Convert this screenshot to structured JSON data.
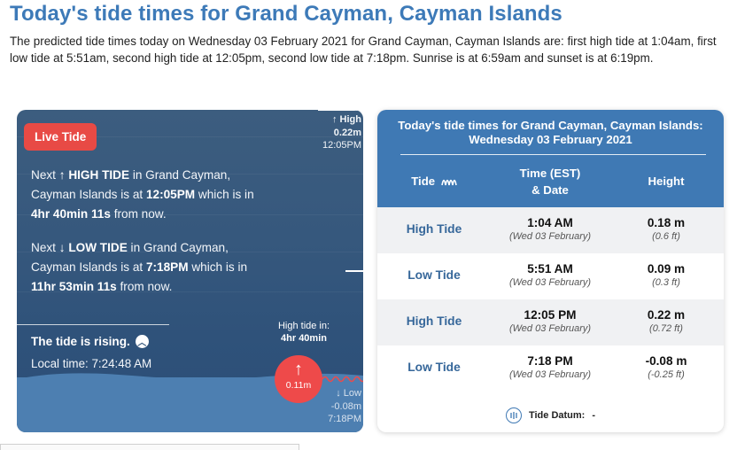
{
  "page": {
    "title": "Today's tide times for Grand Cayman, Cayman Islands",
    "summary": "The predicted tide times today on Wednesday 03 February 2021 for Grand Cayman, Cayman Islands are: first high tide at 1:04am, first low tide at 5:51am, second high tide at 12:05pm, second low tide at 7:18pm. Sunrise is at 6:59am and sunset is at 6:19pm."
  },
  "live": {
    "badge": "Live Tide",
    "next_label": "Next",
    "high": {
      "arrow": "↑",
      "kind": "HIGH TIDE",
      "mid": "in Grand Cayman, Cayman Islands is at",
      "time": "12:05PM",
      "which": "which is in",
      "countdown": "4hr 40min 11s",
      "tail": "from now."
    },
    "low": {
      "arrow": "↓",
      "kind": "LOW TIDE",
      "mid": "in Grand Cayman, Cayman Islands is at",
      "time": "7:18PM",
      "which": "which is in",
      "countdown": "11hr 53min 11s",
      "tail": "from now."
    },
    "rising": "The tide is rising.",
    "local_time": "Local time: 7:24:48 AM",
    "scale_high": {
      "label": "↑ High",
      "height": "0.22m",
      "time": "12:05PM"
    },
    "scale_low": {
      "label": "↓ Low",
      "height": "-0.08m",
      "time": "7:18PM"
    },
    "high_tide_in_label": "High tide in:",
    "high_tide_in_value": "4hr 40min",
    "current_arrow": "↑",
    "current_height": "0.11m",
    "level_fraction": 0.63
  },
  "table": {
    "title": "Today's tide times for Grand Cayman, Cayman Islands: Wednesday 03 February 2021",
    "headers": {
      "tide": "Tide",
      "time_line1": "Time (EST)",
      "time_line2": "& Date",
      "height": "Height"
    },
    "rows": [
      {
        "tide": "High Tide",
        "time": "1:04 AM",
        "date": "(Wed 03 February)",
        "height_m": "0.18 m",
        "height_ft": "(0.6 ft)"
      },
      {
        "tide": "Low Tide",
        "time": "5:51 AM",
        "date": "(Wed 03 February)",
        "height_m": "0.09 m",
        "height_ft": "(0.3 ft)"
      },
      {
        "tide": "High Tide",
        "time": "12:05 PM",
        "date": "(Wed 03 February)",
        "height_m": "0.22 m",
        "height_ft": "(0.72 ft)"
      },
      {
        "tide": "Low Tide",
        "time": "7:18 PM",
        "date": "(Wed 03 February)",
        "height_m": "-0.08 m",
        "height_ft": "(-0.25 ft)"
      }
    ],
    "datum_label": "Tide Datum:",
    "datum_value": "-"
  },
  "colors": {
    "title_blue": "#3d7ab8",
    "header_blue": "#3f79b4",
    "live_red": "#e84a45",
    "water_blue": "#4d7fb1"
  },
  "icons": [
    "arrow-up-icon",
    "arrow-down-icon",
    "wave-icon",
    "chevron-up-circle-icon",
    "tide-datum-icon"
  ]
}
